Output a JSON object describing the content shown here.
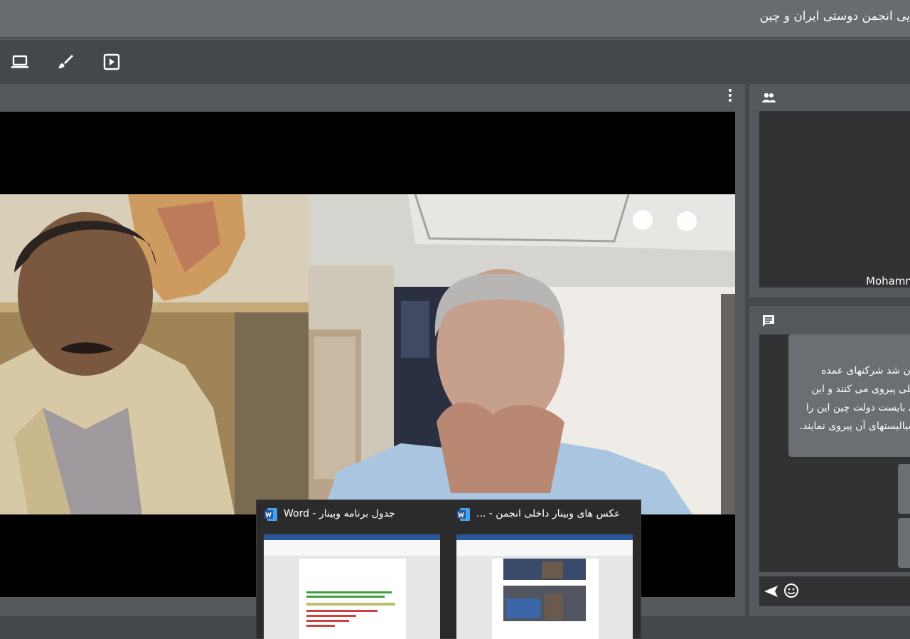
{
  "window": {
    "title": "یی انجمن دوستی ایران و چین"
  },
  "toolbar": {
    "buttons": [
      {
        "name": "screen-share",
        "icon": "laptop-icon"
      },
      {
        "name": "whiteboard",
        "icon": "brush-icon"
      },
      {
        "name": "media-player",
        "icon": "play-box-icon"
      }
    ]
  },
  "video_panel": {
    "menu_icon": "more-vertical-icon",
    "tiles": [
      {
        "name": "participant-video-1"
      },
      {
        "name": "participant-video-2"
      }
    ]
  },
  "participants": {
    "icon": "people-icon",
    "visible_name": "Mohamm"
  },
  "chat": {
    "icon": "chat-icon",
    "message_lines": [
      "یان شد شرکتهای عمده",
      "خلی پیروی می کنند و این",
      "ی بایست دولت چین این را",
      "سیالیستهای آن پیروی نمایند."
    ],
    "send_icon": "send-icon",
    "emoji_icon": "emoji-icon",
    "input_value": ""
  },
  "taskbar_preview": {
    "windows": [
      {
        "title": "جدول برنامه وبینار - Word",
        "icon": "word-icon"
      },
      {
        "title": "عکس های وبینار داخلی انجمن - ...",
        "icon": "word-icon"
      }
    ]
  },
  "colors": {
    "title_bar": "#686b70",
    "toolbar": "#44474b",
    "panel": "#55595e",
    "dark_box": "#303234",
    "chat_bubble": "#6b6e72",
    "taskbar": "#2b2b2b",
    "word_blue": "#2b579a"
  }
}
